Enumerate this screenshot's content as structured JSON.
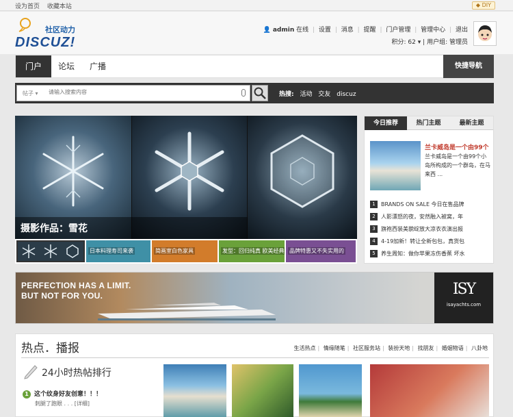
{
  "topbar": {
    "links": [
      "设为首页",
      "收藏本站"
    ],
    "diy": "DIY"
  },
  "header": {
    "logo_sub": "社区动力",
    "logo_main": "DISCUZ!",
    "user": {
      "name": "admin",
      "status": "在线",
      "links": [
        "设置",
        "消息",
        "提醒",
        "门户管理",
        "管理中心",
        "退出"
      ],
      "points_label": "积分: 62",
      "group_label": "用户组: 管理员"
    }
  },
  "nav": {
    "items": [
      "门户",
      "论坛",
      "广播"
    ],
    "quick_nav": "快捷导航"
  },
  "search": {
    "type": "帖子",
    "placeholder": "请输入搜索内容",
    "hot_label": "热搜:",
    "hot_terms": [
      "活动",
      "交友",
      "discuz"
    ]
  },
  "slider": {
    "caption": "摄影作品：雪花",
    "thumbs": [
      "日本料理寿司来袭",
      "简画室白色家具",
      "发型：回归纯真 欧美经典",
      "品牌特惠又不失实用的"
    ]
  },
  "right_panel": {
    "tabs": [
      "今日推荐",
      "热门主题",
      "最新主题"
    ],
    "feature": {
      "title": "兰卡威岛是一个由99个",
      "desc": "兰卡威岛是一个由99个小岛所构成的一个群岛，在马来西 ..."
    },
    "list": [
      "BRANDS ON SALE 今日在售品牌",
      "人影漂怒的夜，安然融入被窝，年",
      "旗袍西装美貌绽放大凉衣衣演出报",
      "4-19加新！转让全新包包，真货包",
      "养生周知：做你苹果冻伤香蕉 坏水"
    ]
  },
  "banner": {
    "line1": "PERFECTION HAS A LIMIT.",
    "line2": "BUT NOT FOR YOU.",
    "brand_mark": "ISY",
    "brand_site": "isayachts.com"
  },
  "hot_section": {
    "title": "热点．播报",
    "tags": [
      "生活热点",
      "情缘随笔",
      "社区服务站",
      "装扮天地",
      "找朋友",
      "婚姻物语",
      "八卦地"
    ],
    "rank_title": "24小时热帖排行",
    "rank_item": "这个纹身好友创意！！！",
    "rank_num": "1",
    "rank_sub": "刺腿了跑眼 . . . [详细]"
  },
  "colors": {
    "dark": "#333333",
    "accent_red": "#c0392b",
    "logo_blue": "#1e4f95"
  }
}
